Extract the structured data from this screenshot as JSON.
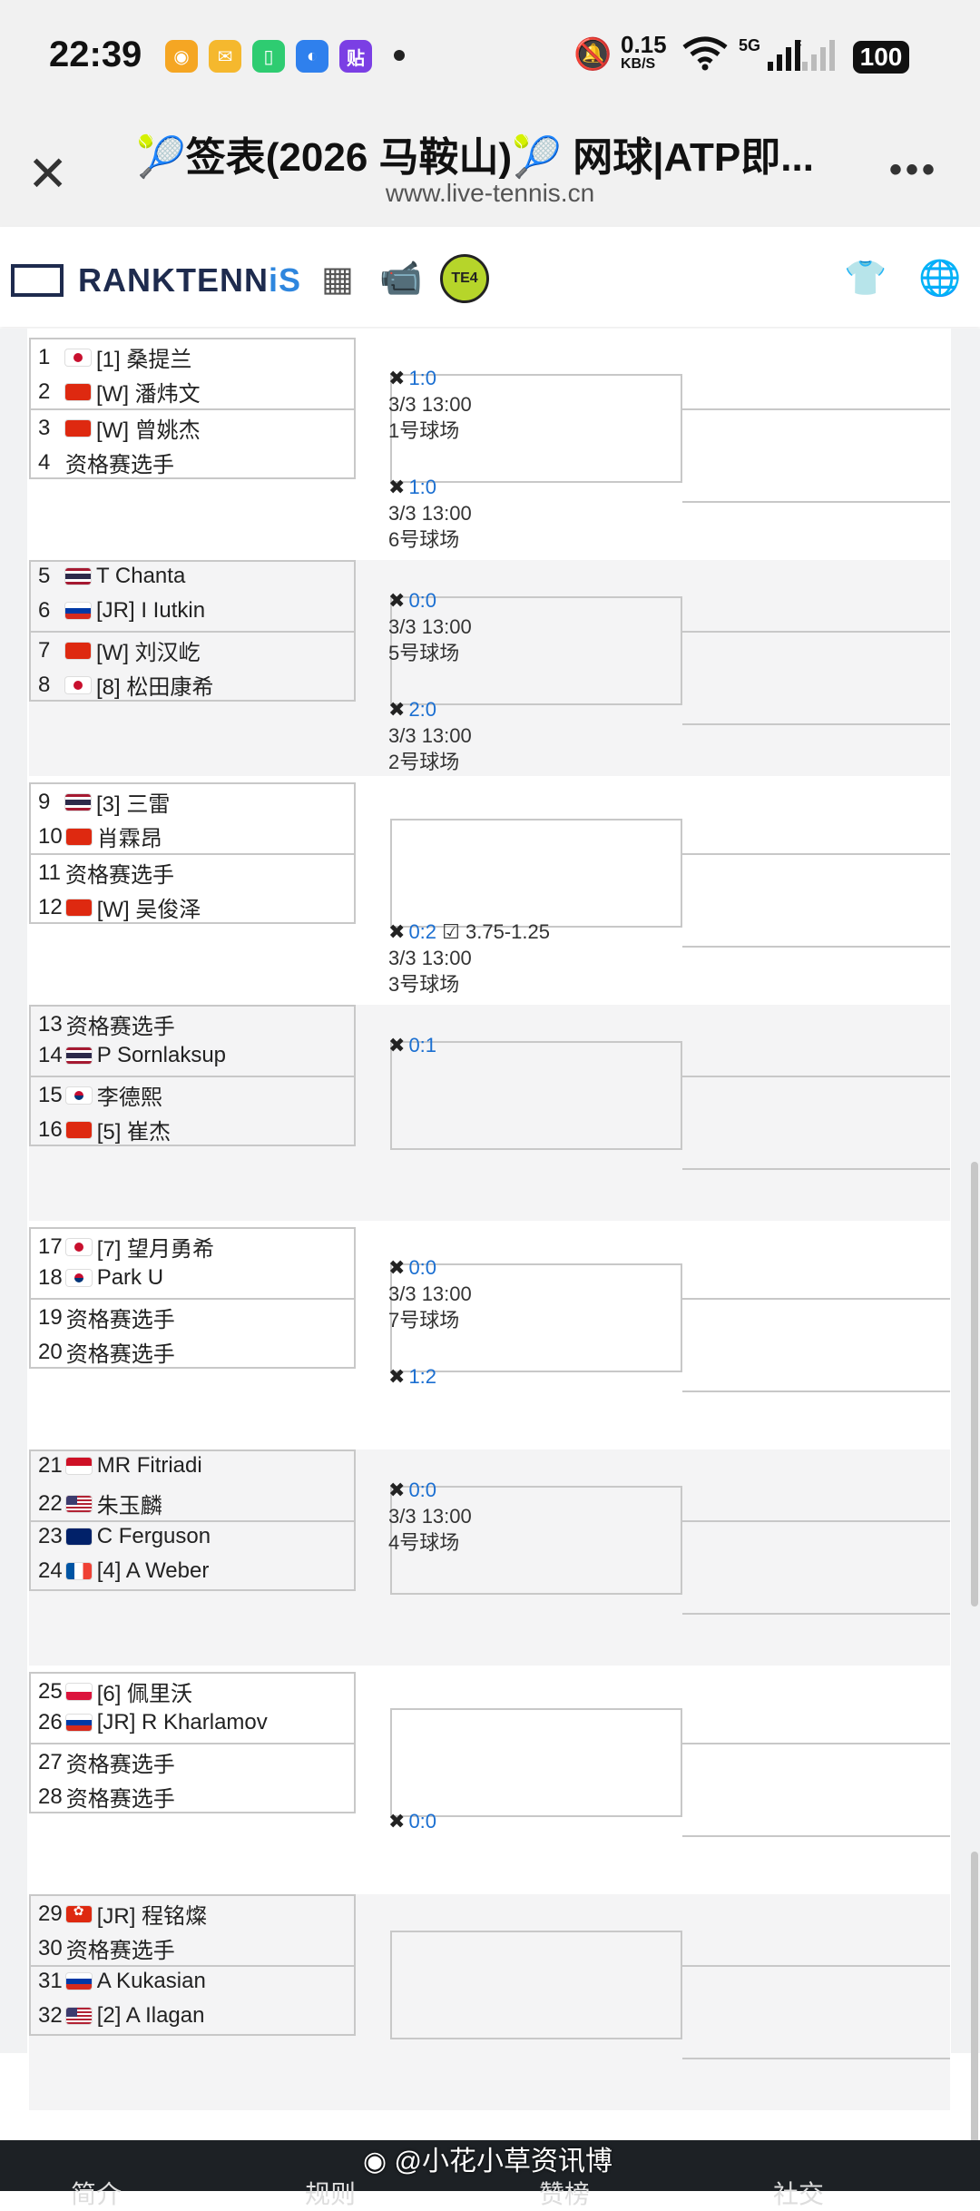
{
  "status_bar": {
    "time": "22:39",
    "net_speed": "0.15",
    "net_unit": "KB/S",
    "signal": "5G",
    "battery": "100"
  },
  "browser": {
    "title": "🎾签表(2026 马鞍山)🎾 网球|ATP即...",
    "url": "www.live-tennis.cn",
    "close_icon": "close-icon",
    "more_icon": "more-icon"
  },
  "site": {
    "logo_main": "RANKTENN",
    "logo_accent": "iS"
  },
  "draw": {
    "players": [
      {
        "n": "1",
        "flag": "jp",
        "name": "[1] 桑提兰"
      },
      {
        "n": "2",
        "flag": "cn",
        "name": "[W] 潘炜文"
      },
      {
        "n": "3",
        "flag": "cn",
        "name": "[W] 曾姚杰"
      },
      {
        "n": "4",
        "flag": "",
        "name": "资格赛选手"
      },
      {
        "n": "5",
        "flag": "th",
        "name": "T Chanta"
      },
      {
        "n": "6",
        "flag": "ru",
        "name": "[JR] I Iutkin"
      },
      {
        "n": "7",
        "flag": "cn",
        "name": "[W] 刘汉屹"
      },
      {
        "n": "8",
        "flag": "jp",
        "name": "[8] 松田康希"
      },
      {
        "n": "9",
        "flag": "th",
        "name": "[3] 三雷"
      },
      {
        "n": "10",
        "flag": "cn",
        "name": "肖霖昂"
      },
      {
        "n": "11",
        "flag": "",
        "name": "资格赛选手"
      },
      {
        "n": "12",
        "flag": "cn",
        "name": "[W] 吴俊泽"
      },
      {
        "n": "13",
        "flag": "",
        "name": "资格赛选手"
      },
      {
        "n": "14",
        "flag": "th",
        "name": "P Sornlaksup"
      },
      {
        "n": "15",
        "flag": "kr",
        "name": "李德熙"
      },
      {
        "n": "16",
        "flag": "cn",
        "name": "[5] 崔杰"
      },
      {
        "n": "17",
        "flag": "jp",
        "name": "[7] 望月勇希"
      },
      {
        "n": "18",
        "flag": "kr",
        "name": "Park U"
      },
      {
        "n": "19",
        "flag": "",
        "name": "资格赛选手"
      },
      {
        "n": "20",
        "flag": "",
        "name": "资格赛选手"
      },
      {
        "n": "21",
        "flag": "id",
        "name": "MR Fitriadi"
      },
      {
        "n": "22",
        "flag": "us",
        "name": "朱玉麟"
      },
      {
        "n": "23",
        "flag": "au",
        "name": "C Ferguson"
      },
      {
        "n": "24",
        "flag": "fr",
        "name": "[4] A Weber"
      },
      {
        "n": "25",
        "flag": "pl",
        "name": "[6] 佩里沃"
      },
      {
        "n": "26",
        "flag": "ru",
        "name": "[JR] R Kharlamov"
      },
      {
        "n": "27",
        "flag": "",
        "name": "资格赛选手"
      },
      {
        "n": "28",
        "flag": "",
        "name": "资格赛选手"
      },
      {
        "n": "29",
        "flag": "hk",
        "name": "[JR] 程铭燦"
      },
      {
        "n": "30",
        "flag": "",
        "name": "资格赛选手"
      },
      {
        "n": "31",
        "flag": "ru",
        "name": "A Kukasian"
      },
      {
        "n": "32",
        "flag": "us",
        "name": "[2] A Ilagan"
      }
    ],
    "matches": [
      {
        "score": "1:0",
        "time": "3/3 13:00",
        "court": "1号球场",
        "odds": ""
      },
      {
        "score": "1:0",
        "time": "3/3 13:00",
        "court": "6号球场",
        "odds": ""
      },
      {
        "score": "0:0",
        "time": "3/3 13:00",
        "court": "5号球场",
        "odds": ""
      },
      {
        "score": "2:0",
        "time": "3/3 13:00",
        "court": "2号球场",
        "odds": ""
      },
      {
        "score": "",
        "time": "",
        "court": "",
        "odds": ""
      },
      {
        "score": "0:2",
        "time": "3/3 13:00",
        "court": "3号球场",
        "odds": "3.75-1.25"
      },
      {
        "score": "0:1",
        "time": "",
        "court": "",
        "odds": ""
      },
      {
        "score": "",
        "time": "",
        "court": "",
        "odds": ""
      },
      {
        "score": "0:0",
        "time": "3/3 13:00",
        "court": "7号球场",
        "odds": ""
      },
      {
        "score": "1:2",
        "time": "",
        "court": "",
        "odds": ""
      },
      {
        "score": "0:0",
        "time": "3/3 13:00",
        "court": "4号球场",
        "odds": ""
      },
      {
        "score": "",
        "time": "",
        "court": "",
        "odds": ""
      },
      {
        "score": "",
        "time": "",
        "court": "",
        "odds": ""
      },
      {
        "score": "0:0",
        "time": "",
        "court": "",
        "odds": ""
      }
    ]
  },
  "footer": {
    "watermark": "@小花小草资讯博",
    "nav": [
      "简介",
      "规则",
      "赞榜",
      "社交"
    ]
  }
}
